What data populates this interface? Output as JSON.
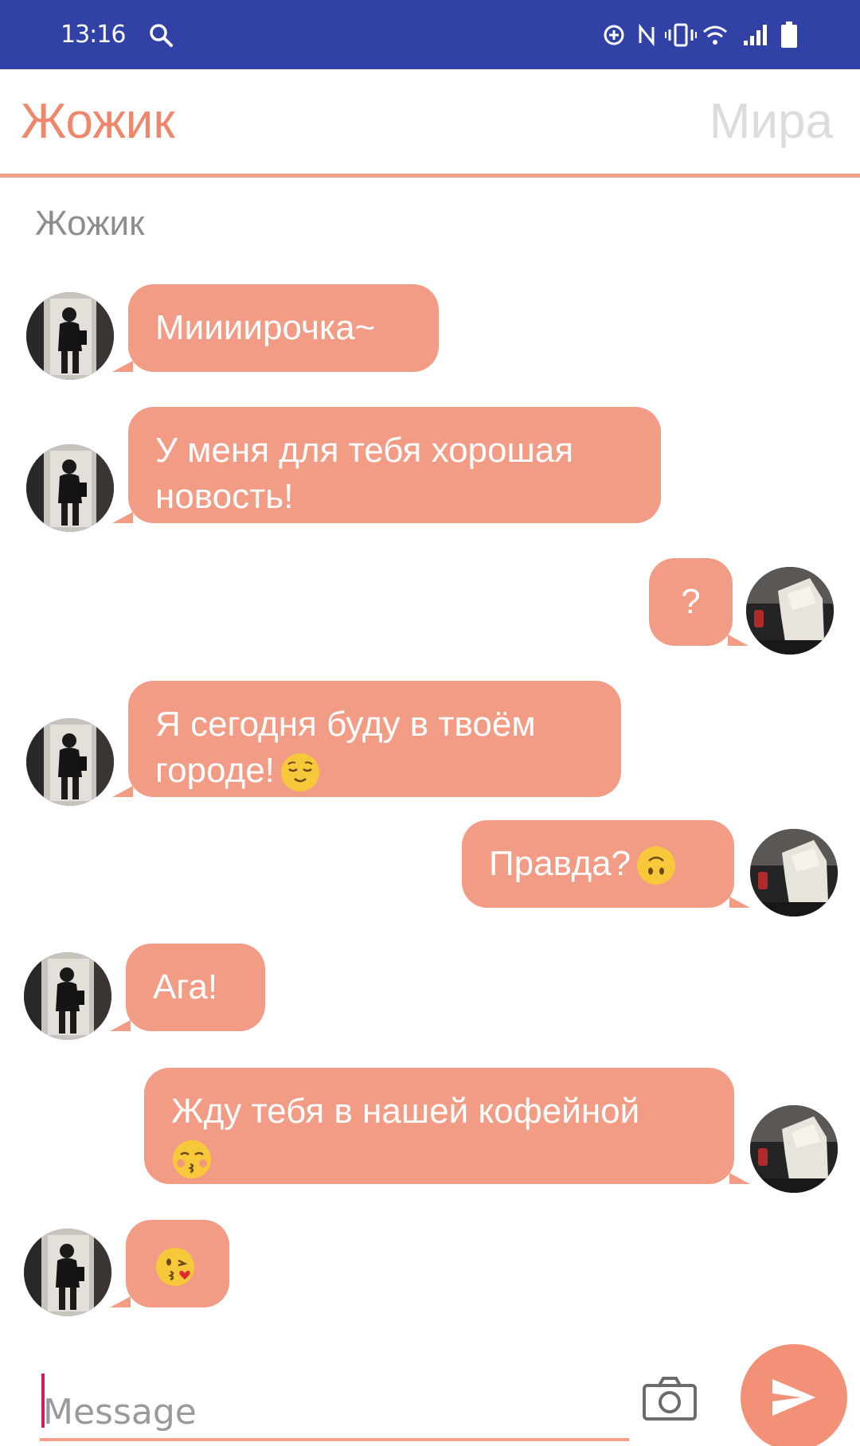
{
  "status_bar": {
    "time": "13:16",
    "icons": [
      "search-icon",
      "data-saver-icon",
      "nfc-icon",
      "vibrate-icon",
      "wifi-icon",
      "signal-icon",
      "battery-icon"
    ],
    "background": "#3241a6"
  },
  "header": {
    "left_name": "Жожик",
    "right_name": "Мира",
    "active_color": "#f0876c",
    "inactive_color": "#dcdcdc"
  },
  "chat": {
    "title": "Жожик",
    "bubble_color": "#f29c85",
    "messages": [
      {
        "side": "in",
        "line1": "Миииирочка~",
        "line2": ""
      },
      {
        "side": "in",
        "line1": "У меня для тебя хорошая",
        "line2": "новость!"
      },
      {
        "side": "out",
        "line1": "?",
        "line2": ""
      },
      {
        "side": "in",
        "line1": "Я сегодня буду в твоём",
        "line2": "городе!",
        "emoji": "relieved-face-emoji"
      },
      {
        "side": "out",
        "line1": "Правда?",
        "line2": "",
        "emoji": "upside-down-face-emoji"
      },
      {
        "side": "in",
        "line1": "Ага!",
        "line2": ""
      },
      {
        "side": "out",
        "line1": "Жду тебя в нашей кофейной",
        "line2": "",
        "emoji": "kissing-closed-eyes-emoji"
      },
      {
        "side": "in",
        "line1": "",
        "line2": "",
        "emoji": "face-blowing-kiss-emoji"
      }
    ]
  },
  "input": {
    "placeholder": "Message",
    "value": ""
  }
}
